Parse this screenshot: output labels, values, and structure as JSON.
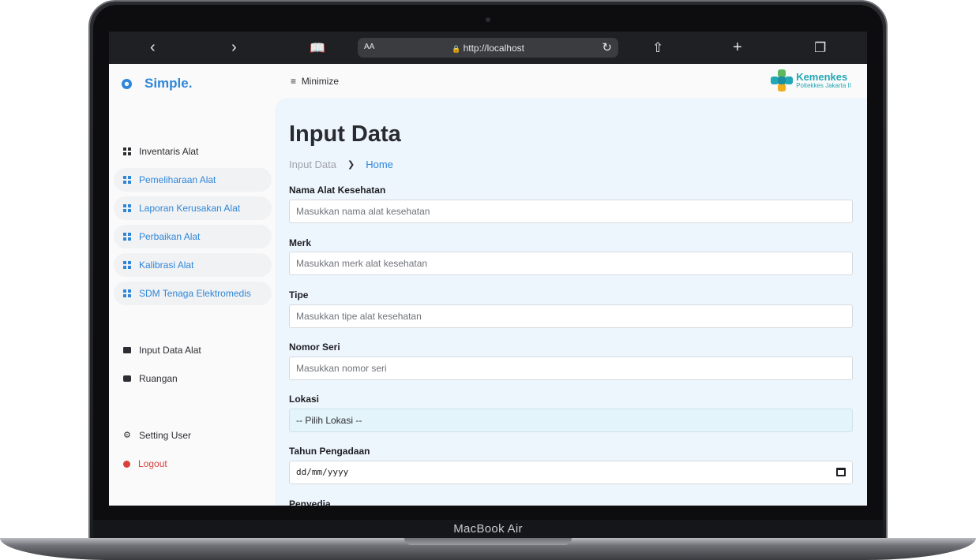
{
  "device": {
    "label": "MacBook Air"
  },
  "browser": {
    "text_size": "AA",
    "url": "http://localhost",
    "icons": [
      "back-icon",
      "forward-icon",
      "book-icon",
      "lock-icon",
      "reload-icon",
      "share-icon",
      "plus-icon",
      "tabs-icon"
    ]
  },
  "sidebar": {
    "brand": "Simple.",
    "items": [
      {
        "label": "Inventaris Alat",
        "icon": "grid-icon"
      },
      {
        "label": "Pemeliharaan Alat",
        "icon": "grid-icon"
      },
      {
        "label": "Laporan Kerusakan Alat",
        "icon": "grid-icon"
      },
      {
        "label": "Perbaikan Alat",
        "icon": "grid-icon"
      },
      {
        "label": "Kalibrasi Alat",
        "icon": "grid-icon"
      },
      {
        "label": "SDM Tenaga Elektromedis",
        "icon": "grid-icon"
      },
      {
        "label": "Input Data Alat",
        "icon": "mail-icon"
      },
      {
        "label": "Ruangan",
        "icon": "chat-icon"
      },
      {
        "label": "Setting User",
        "icon": "gear-icon"
      },
      {
        "label": "Logout",
        "icon": "logout-icon"
      }
    ]
  },
  "topbar": {
    "minimize_label": "Minimize",
    "logo_title": "Kemenkes",
    "logo_subtitle": "Poltekkes Jakarta II"
  },
  "main": {
    "title": "Input Data",
    "breadcrumb": [
      "Input Data",
      "Home"
    ],
    "form": {
      "nama_label": "Nama Alat Kesehatan",
      "nama_placeholder": "Masukkan nama alat kesehatan",
      "merk_label": "Merk",
      "merk_placeholder": "Masukkan merk alat kesehatan",
      "tipe_label": "Tipe",
      "tipe_placeholder": "Masukkan tipe alat kesehatan",
      "seri_label": "Nomor Seri",
      "seri_placeholder": "Masukkan nomor seri",
      "lokasi_label": "Lokasi",
      "lokasi_value": "-- Pilih Lokasi --",
      "tahun_label": "Tahun Pengadaan",
      "tahun_placeholder": "dd/mm/yyyy",
      "penyedia_label": "Penyedia"
    }
  },
  "colors": {
    "accent": "#2f86d8",
    "danger": "#d9413c",
    "main_bg": "#eef6fd",
    "logo": "#22a7b4"
  }
}
